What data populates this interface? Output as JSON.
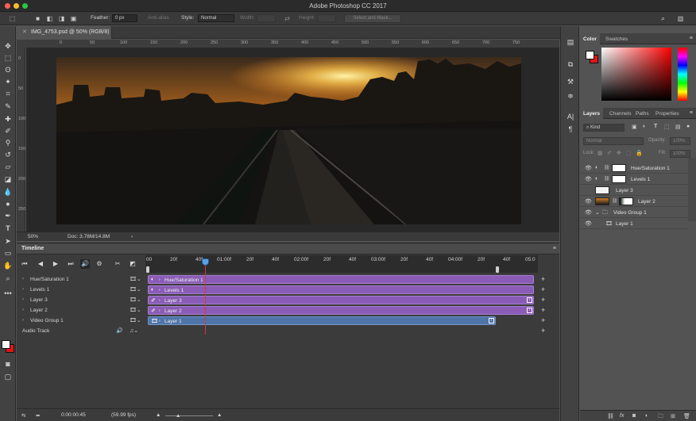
{
  "window": {
    "title": "Adobe Photoshop CC 2017"
  },
  "options_bar": {
    "feather_label": "Feather:",
    "feather_value": "0 px",
    "anti_alias_label": "Anti-alias",
    "style_label": "Style:",
    "style_value": "Normal",
    "width_label": "Width:",
    "height_label": "Height:",
    "select_mask_label": "Select and Mask..."
  },
  "document": {
    "tab_title": "IMG_4753.psd @ 50% (RGB/8)",
    "zoom": "50%",
    "doc_size": "Doc: 3.78M/14.8M",
    "ruler_ticks": [
      "0",
      "50",
      "100",
      "150",
      "200",
      "250",
      "300",
      "350",
      "400",
      "450",
      "500",
      "550",
      "600",
      "650",
      "700",
      "750"
    ]
  },
  "timeline": {
    "tab_label": "Timeline",
    "ticks": [
      "00",
      "20f",
      "40f",
      "01:00f",
      "20f",
      "40f",
      "02:00f",
      "20f",
      "40f",
      "03:00f",
      "20f",
      "40f",
      "04:00f",
      "20f",
      "40f",
      "05:0"
    ],
    "tracks": [
      {
        "label": "Hue/Saturation 1",
        "clip": "Hue/Saturation 1",
        "clip_color": "purple",
        "clip_icon": "adjustment-icon"
      },
      {
        "label": "Levels 1",
        "clip": "Levels 1",
        "clip_color": "purple",
        "clip_icon": "adjustment-icon"
      },
      {
        "label": "Layer 3",
        "clip": "Layer 3",
        "clip_color": "purple",
        "clip_icon": "brush-icon"
      },
      {
        "label": "Layer 2",
        "clip": "Layer 2",
        "clip_color": "purple",
        "clip_icon": "brush-icon"
      },
      {
        "label": "Video Group 1",
        "clip": "Layer 1",
        "clip_color": "blue",
        "clip_icon": "film-icon"
      }
    ],
    "audio_track_label": "Audio Track",
    "current_time": "0:00:00:45",
    "fps": "(59.99 fps)"
  },
  "color_panel": {
    "tabs": [
      "Color",
      "Swatches"
    ]
  },
  "layers_panel": {
    "tabs": [
      "Layers",
      "Channels",
      "Paths",
      "Properties"
    ],
    "filter_kind": "Kind",
    "blend_mode": "Normal",
    "opacity_label": "Opacity:",
    "opacity_value": "100%",
    "lock_label": "Lock:",
    "fill_label": "Fill:",
    "fill_value": "100%",
    "layers": [
      {
        "name": "Hue/Saturation 1",
        "visible": true,
        "type": "adjustment"
      },
      {
        "name": "Levels 1",
        "visible": true,
        "type": "adjustment"
      },
      {
        "name": "Layer 3",
        "visible": false,
        "type": "pixel"
      },
      {
        "name": "Layer 2",
        "visible": true,
        "type": "pixel-masked"
      },
      {
        "name": "Video Group 1",
        "visible": true,
        "type": "group"
      },
      {
        "name": "Layer 1",
        "visible": true,
        "type": "video"
      }
    ]
  },
  "colors": {
    "foreground": "#ffffff",
    "background": "#e4141b",
    "clip_purple": "#8a5cb5",
    "clip_blue": "#4f74a8",
    "playhead": "#d23a3a"
  }
}
